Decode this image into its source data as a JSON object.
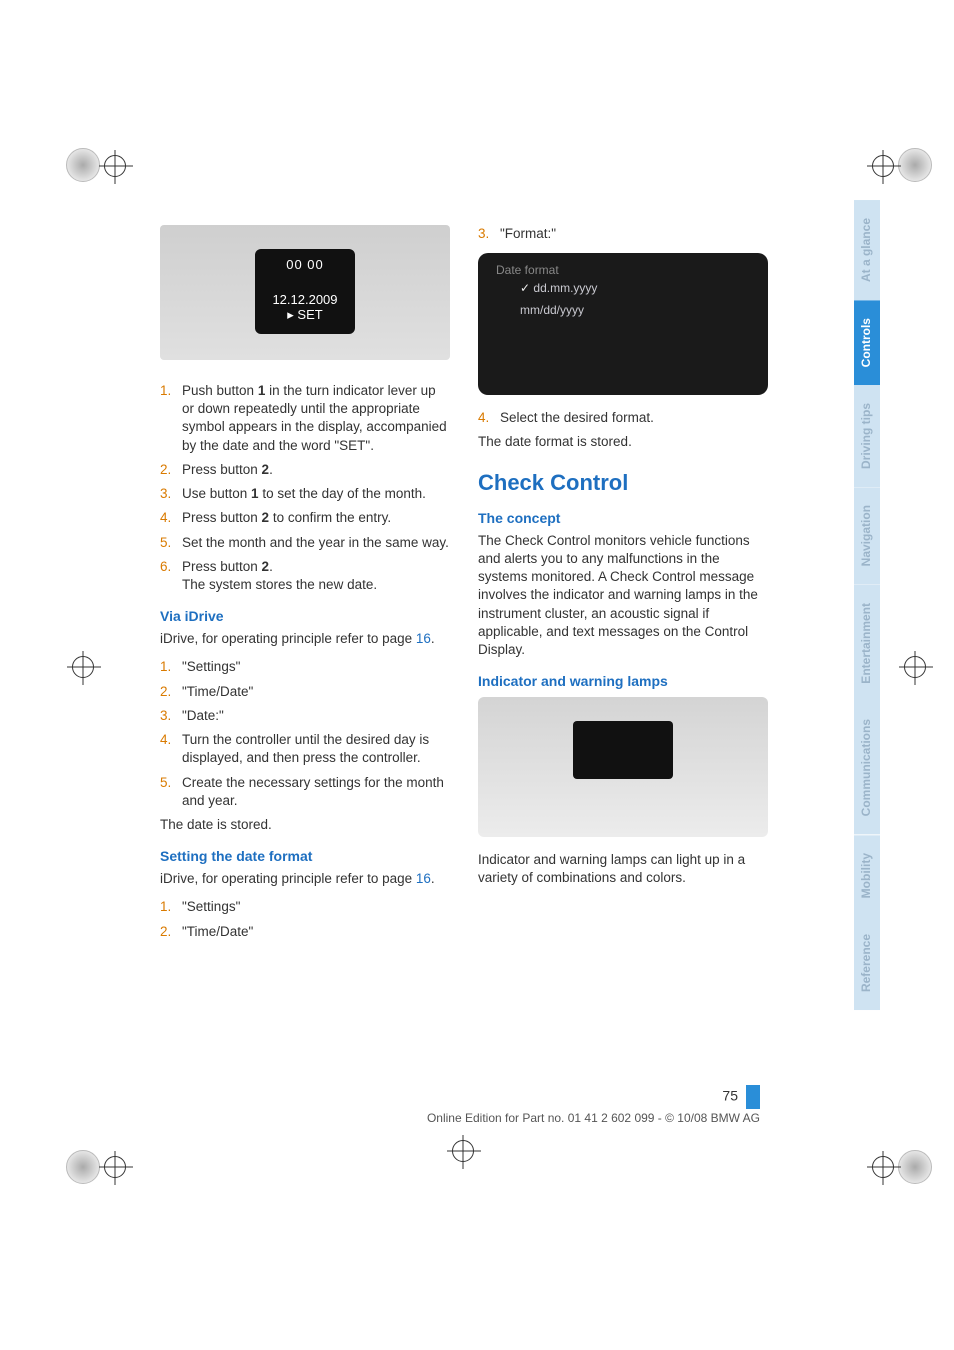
{
  "page_number": "75",
  "footer_line": "Online Edition for Part no. 01 41 2 602 099 - © 10/08 BMW AG",
  "tabs": {
    "at_a_glance": "At a glance",
    "controls": "Controls",
    "driving_tips": "Driving tips",
    "navigation": "Navigation",
    "entertainment": "Entertainment",
    "communications": "Communications",
    "mobility": "Mobility",
    "reference": "Reference"
  },
  "fig1": {
    "digits": "00 00",
    "date": "12.12.2009",
    "set": "SET"
  },
  "left": {
    "steps_a": [
      {
        "n": "1.",
        "t_pre": "Push button ",
        "b": "1",
        "t_post": " in the turn indicator lever up or down repeatedly until the appropriate symbol appears in the display, accompanied by the date and the word \"SET\"."
      },
      {
        "n": "2.",
        "t_pre": "Press button ",
        "b": "2",
        "t_post": "."
      },
      {
        "n": "3.",
        "t_pre": "Use button ",
        "b": "1",
        "t_post": " to set the day of the month."
      },
      {
        "n": "4.",
        "t_pre": "Press button ",
        "b": "2",
        "t_post": " to confirm the entry."
      },
      {
        "n": "5.",
        "t": "Set the month and the year in the same way."
      },
      {
        "n": "6.",
        "t_pre": "Press button ",
        "b": "2",
        "t_post": ".",
        "t2": "The system stores the new date."
      }
    ],
    "h_via": "Via iDrive",
    "idrive_intro_pre": "iDrive, for operating principle refer to page ",
    "idrive_intro_link": "16",
    "idrive_intro_post": ".",
    "steps_b": [
      {
        "n": "1.",
        "t": "\"Settings\""
      },
      {
        "n": "2.",
        "t": "\"Time/Date\""
      },
      {
        "n": "3.",
        "t": "\"Date:\""
      },
      {
        "n": "4.",
        "t": "Turn the controller until the desired day is displayed, and then press the controller."
      },
      {
        "n": "5.",
        "t": "Create the necessary settings for the month and year."
      }
    ],
    "stored": "The date is stored.",
    "h_fmt": "Setting the date format",
    "steps_c": [
      {
        "n": "1.",
        "t": "\"Settings\""
      },
      {
        "n": "2.",
        "t": "\"Time/Date\""
      }
    ]
  },
  "right": {
    "step3": {
      "n": "3.",
      "t": "\"Format:\""
    },
    "fig2": {
      "title": "Date format",
      "opt1": "dd.mm.yyyy",
      "opt2": "mm/dd/yyyy"
    },
    "step4": {
      "n": "4.",
      "t": "Select the desired format."
    },
    "fmt_stored": "The date format is stored.",
    "h_check": "Check Control",
    "h_concept": "The concept",
    "concept_body": "The Check Control monitors vehicle functions and alerts you to any malfunctions in the systems monitored. A Check Control message involves the indicator and warning lamps in the instrument cluster, an acoustic signal if applicable, and text messages on the Control Display.",
    "h_lamps": "Indicator and warning lamps",
    "lamps_body": "Indicator and warning lamps can light up in a variety of combinations and colors."
  }
}
